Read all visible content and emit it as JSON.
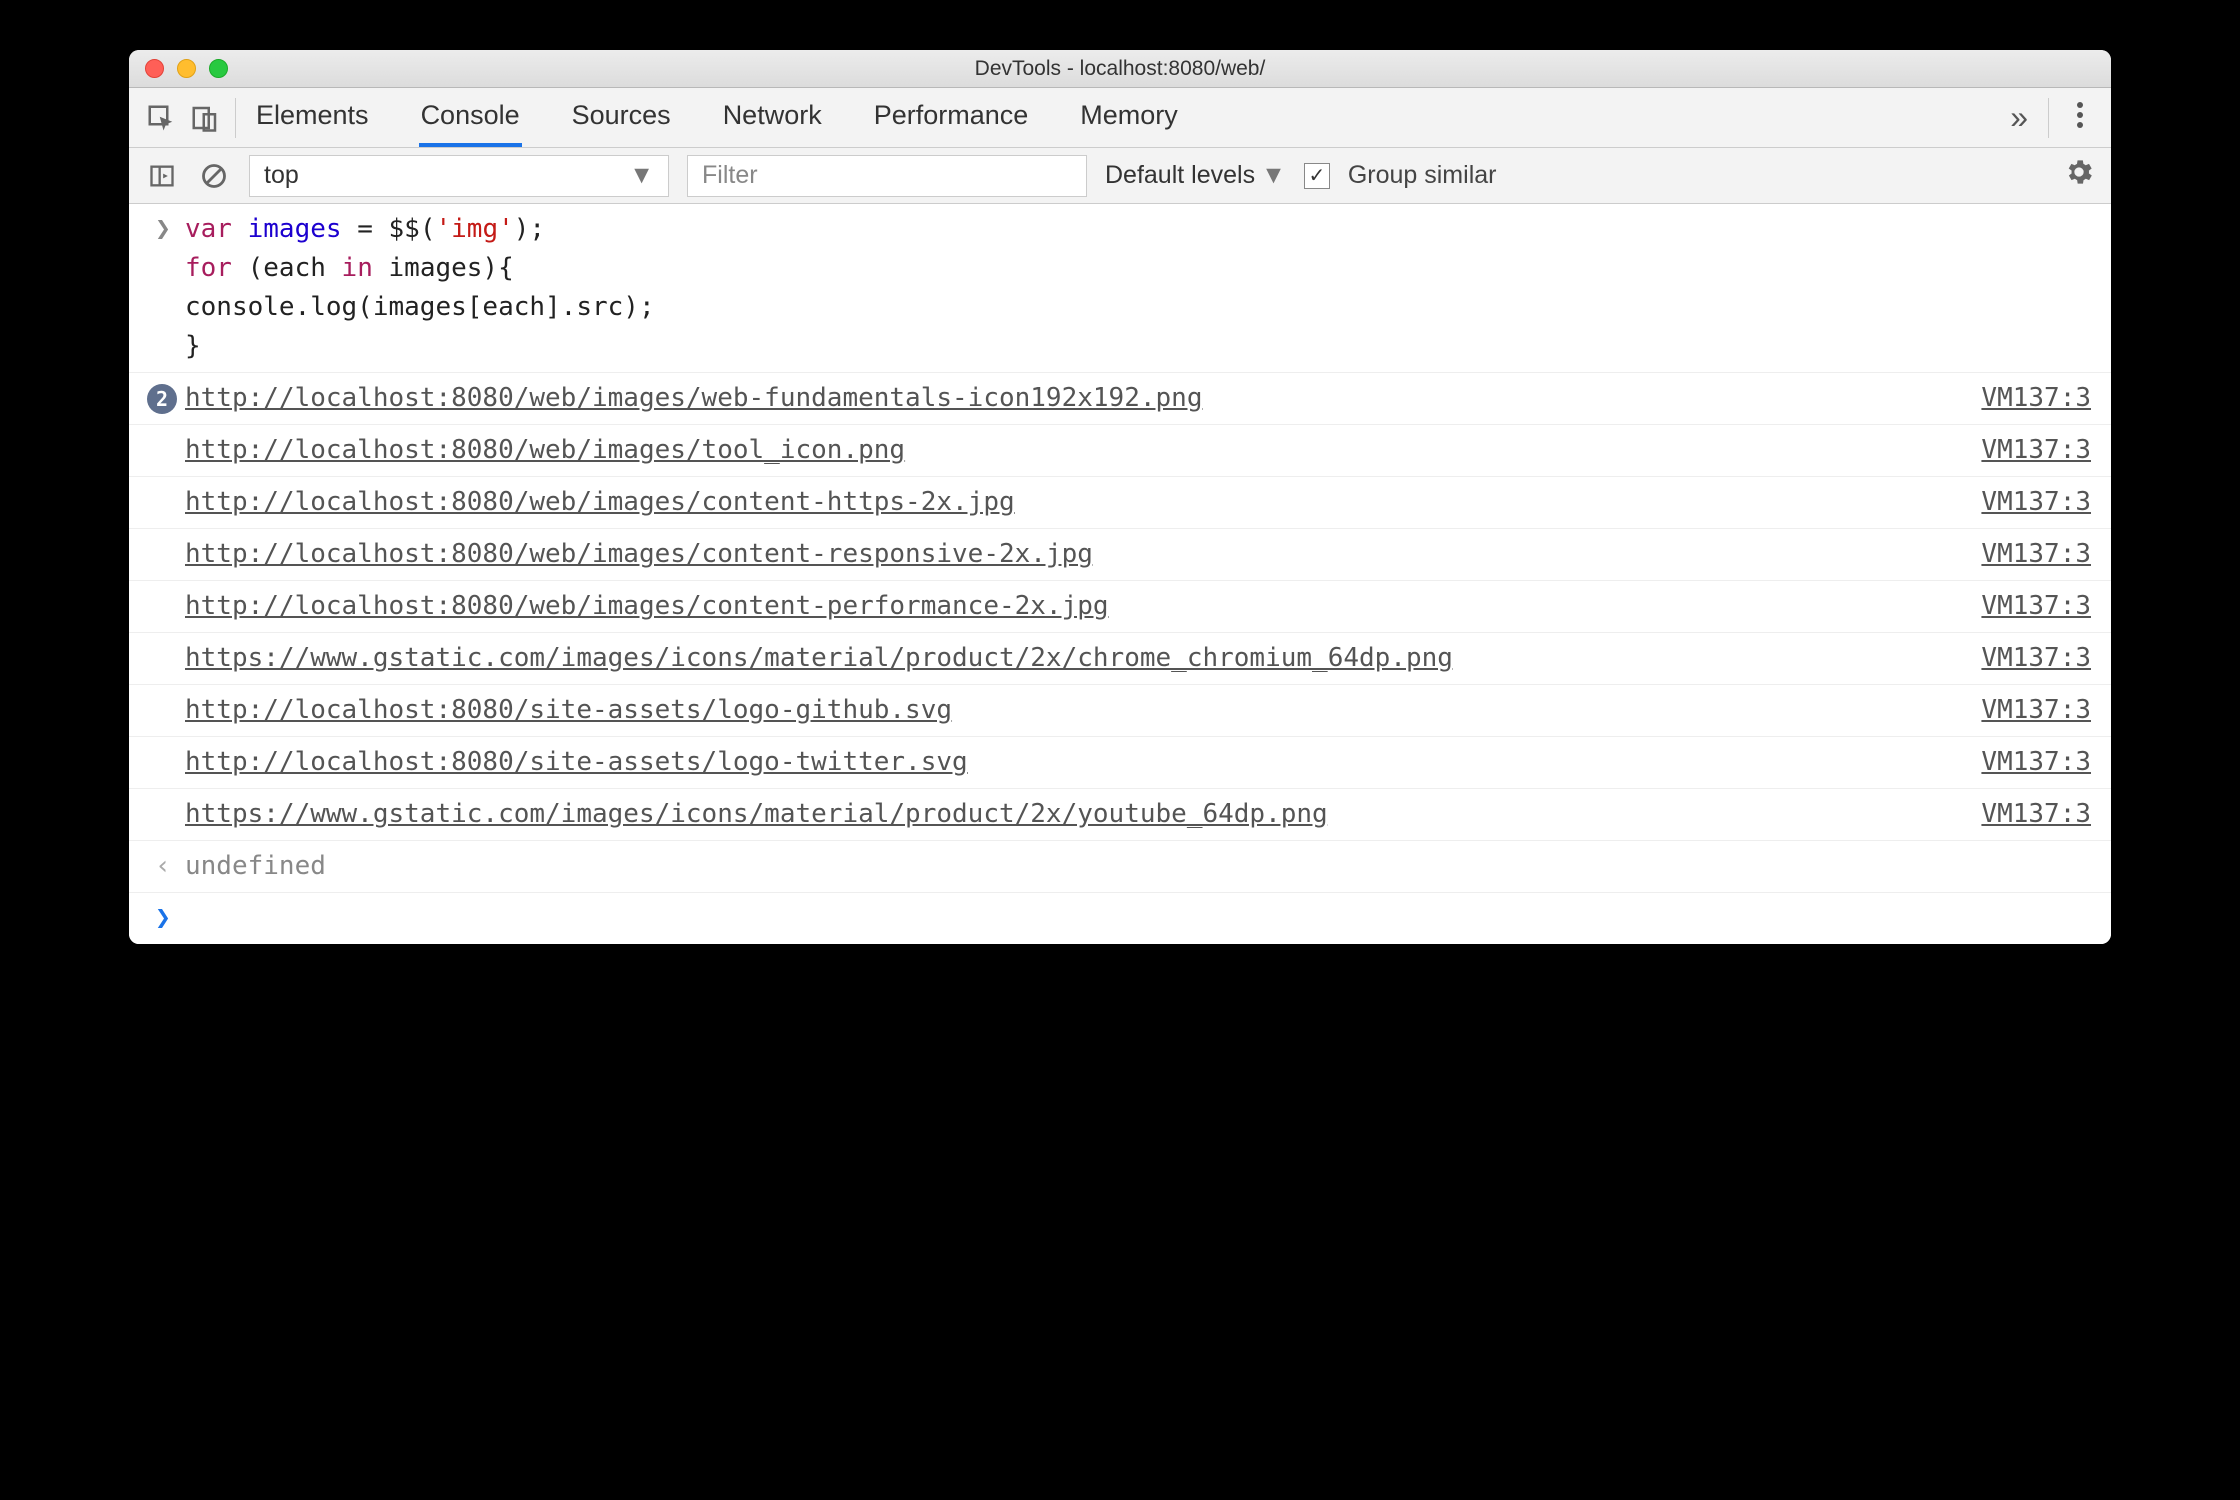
{
  "window": {
    "title": "DevTools - localhost:8080/web/"
  },
  "tabs": {
    "items": [
      "Elements",
      "Console",
      "Sources",
      "Network",
      "Performance",
      "Memory"
    ],
    "active": "Console",
    "more_glyph": "»"
  },
  "toolbar": {
    "context": "top",
    "filter_placeholder": "Filter",
    "levels_label": "Default levels",
    "group_similar_label": "Group similar",
    "group_similar_checked": true
  },
  "code": {
    "l1_kw_var": "var",
    "l1_ident": " images ",
    "l1_eq": "= $$(",
    "l1_str": "'img'",
    "l1_end": ");",
    "l2_kw_for": "for",
    "l2_open": " (each ",
    "l2_kw_in": "in",
    "l2_rest": " images){",
    "l3_indent": "    console.log(images[each].src);",
    "l4_close": "}"
  },
  "logs": [
    {
      "badge": "2",
      "url": "http://localhost:8080/web/images/web-fundamentals-icon192x192.png",
      "src": "VM137:3"
    },
    {
      "url": "http://localhost:8080/web/images/tool_icon.png",
      "src": "VM137:3"
    },
    {
      "url": "http://localhost:8080/web/images/content-https-2x.jpg",
      "src": "VM137:3"
    },
    {
      "url": "http://localhost:8080/web/images/content-responsive-2x.jpg",
      "src": "VM137:3"
    },
    {
      "url": "http://localhost:8080/web/images/content-performance-2x.jpg",
      "src": "VM137:3"
    },
    {
      "url": "https://www.gstatic.com/images/icons/material/product/2x/chrome_chromium_64dp.png",
      "src": "VM137:3"
    },
    {
      "url": "http://localhost:8080/site-assets/logo-github.svg",
      "src": "VM137:3"
    },
    {
      "url": "http://localhost:8080/site-assets/logo-twitter.svg",
      "src": "VM137:3"
    },
    {
      "url": "https://www.gstatic.com/images/icons/material/product/2x/youtube_64dp.png",
      "src": "VM137:3"
    }
  ],
  "result": {
    "value": "undefined"
  }
}
